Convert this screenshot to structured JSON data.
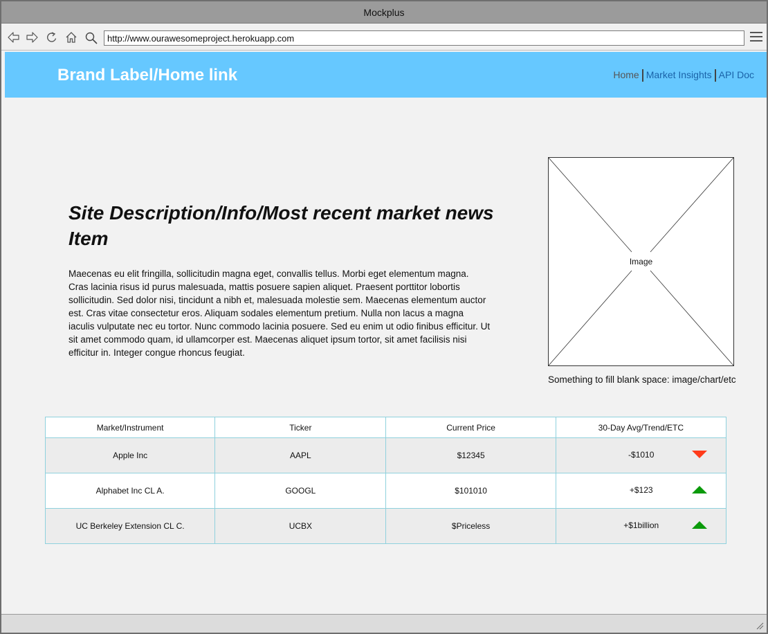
{
  "window": {
    "title": "Mockplus"
  },
  "browser": {
    "url": "http://www.ourawesomeproject.herokuapp.com"
  },
  "header": {
    "brand": "Brand Label/Home link",
    "nav": {
      "home": "Home",
      "market": "Market Insights",
      "api": "API Doc"
    }
  },
  "hero": {
    "headline": "Site Description/Info/Most recent market news Item",
    "body": "Maecenas eu elit fringilla, sollicitudin magna eget, convallis tellus. Morbi eget elementum magna. Cras lacinia risus id purus malesuada, mattis posuere sapien aliquet. Praesent porttitor lobortis sollicitudin. Sed dolor nisi, tincidunt a nibh et, malesuada molestie sem. Maecenas elementum auctor est. Cras vitae consectetur eros. Aliquam sodales elementum pretium. Nulla non lacus a magna iaculis vulputate nec eu tortor. Nunc commodo lacinia posuere. Sed eu enim ut odio finibus efficitur. Ut sit amet commodo quam, id ullamcorper est. Maecenas aliquet ipsum tortor, sit amet facilisis nisi efficitur in. Integer congue rhoncus feugiat."
  },
  "image": {
    "label": "Image",
    "caption": "Something to fill blank space: image/chart/etc"
  },
  "table": {
    "headers": [
      "Market/Instrument",
      "Ticker",
      "Current Price",
      "30-Day Avg/Trend/ETC"
    ],
    "rows": [
      {
        "name": "Apple Inc",
        "ticker": "AAPL",
        "price": "$12345",
        "trend": "-$1010",
        "direction": "down"
      },
      {
        "name": "Alphabet Inc CL A.",
        "ticker": "GOOGL",
        "price": "$101010",
        "trend": "+$123",
        "direction": "up"
      },
      {
        "name": "UC Berkeley Extension CL C.",
        "ticker": "UCBX",
        "price": "$Priceless",
        "trend": "+$1billion",
        "direction": "up"
      }
    ]
  },
  "colors": {
    "header_bg": "#66c8ff",
    "up": "#0a9a0a",
    "down": "#ff3b1a"
  },
  "icons": [
    "back-arrow-icon",
    "forward-arrow-icon",
    "refresh-icon",
    "home-icon",
    "search-icon",
    "menu-icon",
    "resize-grip-icon"
  ]
}
